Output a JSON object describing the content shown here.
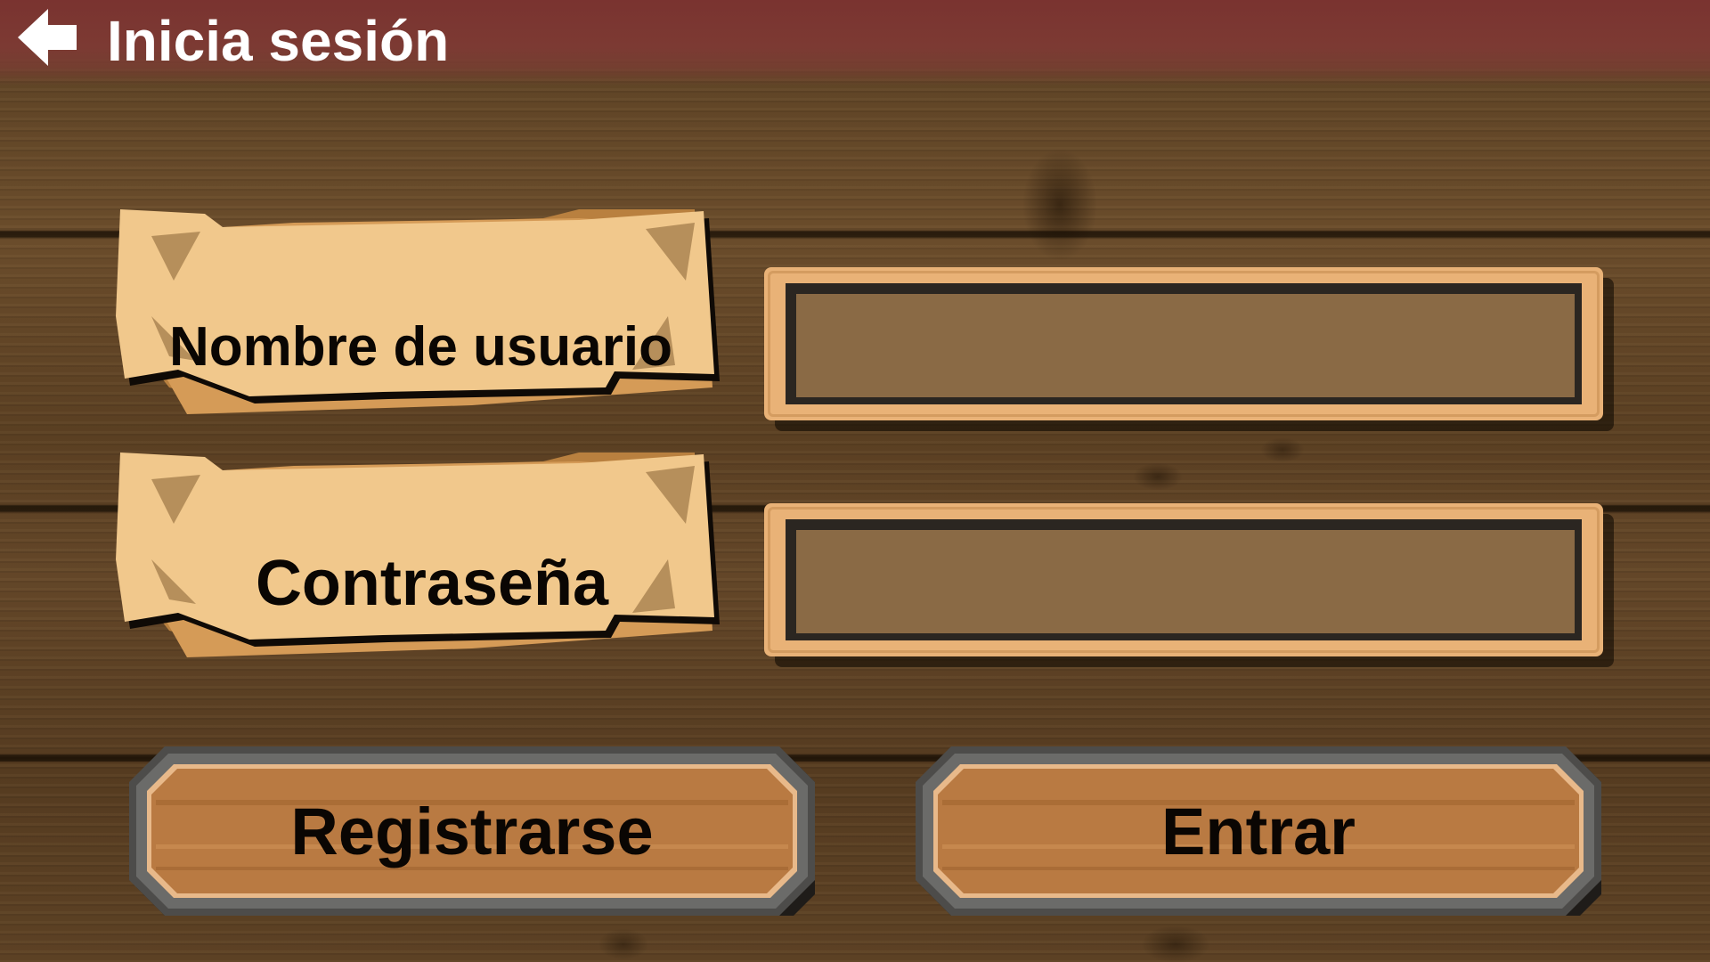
{
  "header": {
    "title": "Inicia sesión",
    "back_icon": "back-arrow-icon"
  },
  "form": {
    "username_label": "Nombre de usuario",
    "username_value": "",
    "password_label": "Contraseña",
    "password_value": ""
  },
  "actions": {
    "register_label": "Registrarse",
    "enter_label": "Entrar"
  },
  "colors": {
    "title_bar": "#7c3a33",
    "wood_background": "#5a3f22",
    "parchment": "#f1c88c",
    "input_frame": "#e9b277",
    "input_fill": "#8a6a45",
    "button_frame": "#4a4a4a",
    "button_wood": "#b97a42"
  }
}
